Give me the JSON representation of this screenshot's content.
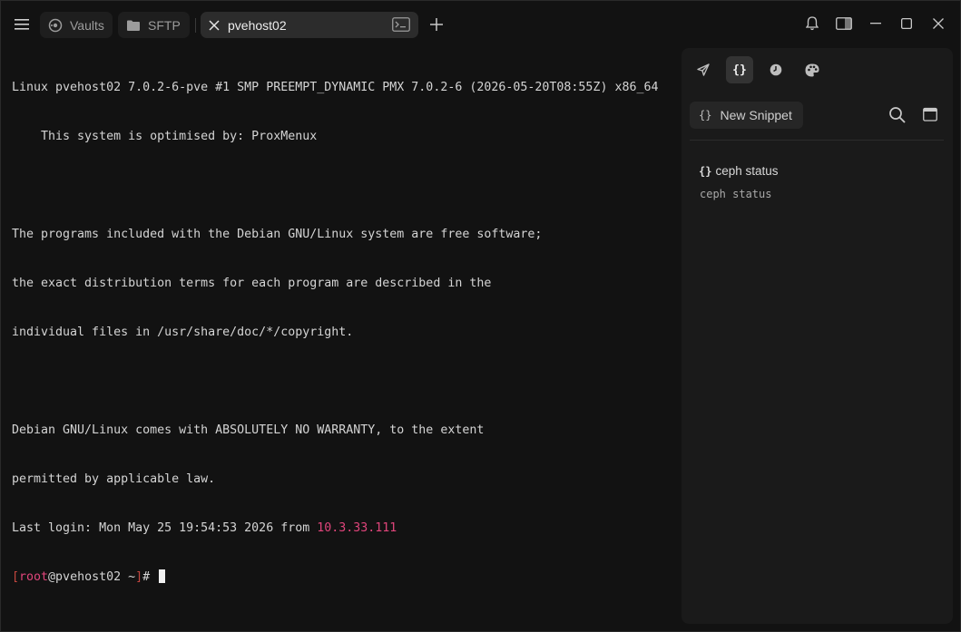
{
  "titlebar": {
    "menu_icon": "hamburger-icon",
    "tabs": [
      {
        "label": "Vaults",
        "icon": "vault-icon"
      },
      {
        "label": "SFTP",
        "icon": "folder-icon"
      },
      {
        "label": "pvehost02",
        "icon": "terminal-icon",
        "active": true
      }
    ],
    "new_tab_icon": "plus-icon",
    "controls": [
      "bell-icon",
      "panel-toggle-icon",
      "minimize-icon",
      "maximize-icon",
      "close-icon"
    ]
  },
  "terminal": {
    "lines": [
      "Linux pvehost02 7.0.2-6-pve #1 SMP PREEMPT_DYNAMIC PMX 7.0.2-6 (2026-05-20T08:55Z) x86_64",
      "    This system is optimised by: ProxMenux",
      "",
      "The programs included with the Debian GNU/Linux system are free software;",
      "the exact distribution terms for each program are described in the",
      "individual files in /usr/share/doc/*/copyright.",
      "",
      "Debian GNU/Linux comes with ABSOLUTELY NO WARRANTY, to the extent",
      "permitted by applicable law."
    ],
    "last_login_prefix": "Last login: Mon May 25 19:54:53 2026 from ",
    "last_login_ip": "10.3.33.111",
    "prompt": {
      "open_bracket": "[",
      "user": "root",
      "at_host": "@pvehost02 ~",
      "close_bracket": "]",
      "symbol": "# "
    }
  },
  "panel": {
    "tabs": [
      {
        "name": "connect",
        "icon": "send-icon"
      },
      {
        "name": "snippets",
        "icon": "braces-icon",
        "label": "{}",
        "active": true
      },
      {
        "name": "history",
        "icon": "clock-icon"
      },
      {
        "name": "themes",
        "icon": "palette-icon"
      }
    ],
    "new_snippet_icon": "{}",
    "new_snippet_label": "New Snippet",
    "search_icon": "search-icon",
    "calendar_icon": "calendar-icon",
    "snippets": [
      {
        "icon": "{}",
        "title": "ceph status",
        "command": "ceph status"
      }
    ]
  },
  "colors": {
    "background": "#121212",
    "panel": "#1a1a1a",
    "ip_highlight": "#e0457b",
    "prompt_bracket": "#c4463f"
  }
}
